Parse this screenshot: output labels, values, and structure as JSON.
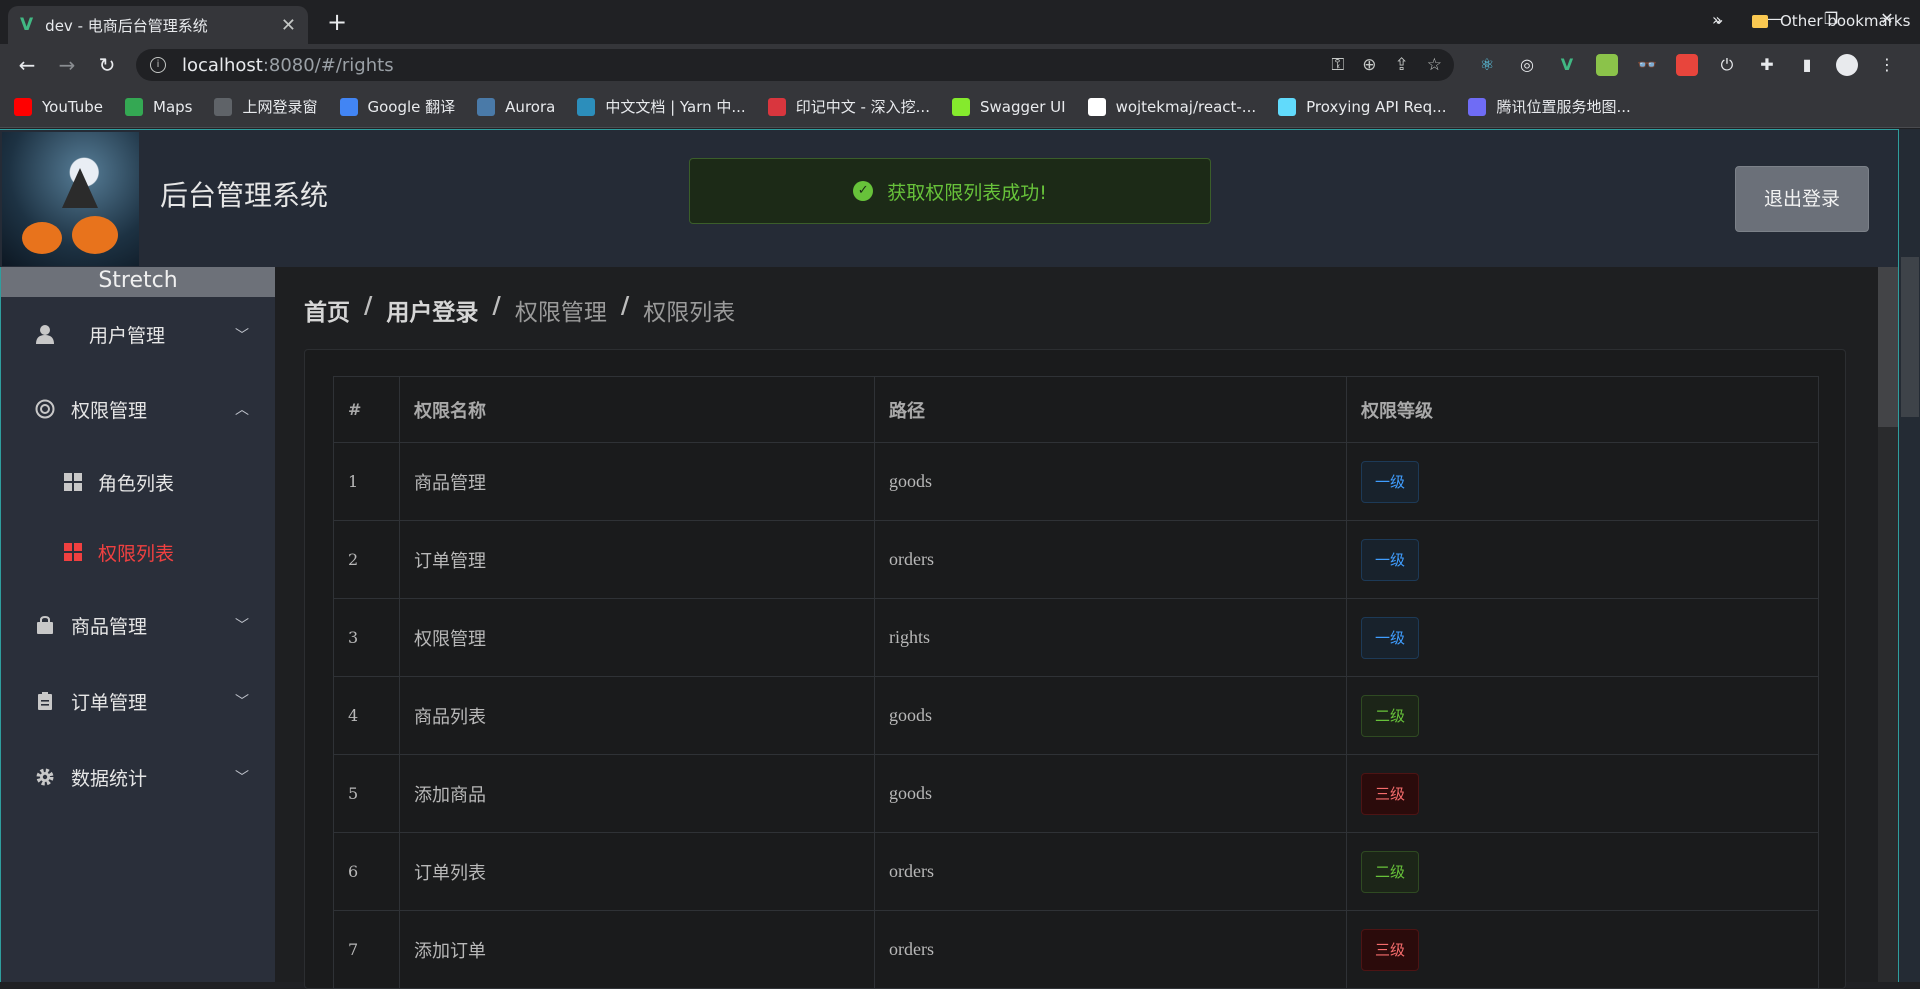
{
  "browser": {
    "tab_title": "dev - 电商后台管理系统",
    "tab_favicon": "V",
    "url_host": "localhost",
    "url_path": ":8080/#/rights",
    "bookmarks": [
      {
        "label": "YouTube",
        "icon": "youtube-icon",
        "color": "#ff0000"
      },
      {
        "label": "Maps",
        "icon": "maps-icon",
        "color": "#34a853"
      },
      {
        "label": "上网登录窗",
        "icon": "globe-icon",
        "color": "#5f6368"
      },
      {
        "label": "Google 翻译",
        "icon": "translate-icon",
        "color": "#4285f4"
      },
      {
        "label": "Aurora",
        "icon": "aurora-icon",
        "color": "#4a7aa8"
      },
      {
        "label": "中文文档 | Yarn 中...",
        "icon": "yarn-icon",
        "color": "#2c8ebb"
      },
      {
        "label": "印记中文 - 深入挖...",
        "icon": "docschina-icon",
        "color": "#d9363e"
      },
      {
        "label": "Swagger UI",
        "icon": "swagger-icon",
        "color": "#85ea2d"
      },
      {
        "label": "wojtekmaj/react-...",
        "icon": "github-icon",
        "color": "#ffffff"
      },
      {
        "label": "Proxying API Req...",
        "icon": "react-icon",
        "color": "#61dafb"
      },
      {
        "label": "腾讯位置服务地图...",
        "icon": "tencent-map-icon",
        "color": "#6f6cf5"
      }
    ],
    "bookmarks_more": "»",
    "other_bookmarks": "Other bookmarks"
  },
  "header": {
    "title": "后台管理系统",
    "toast": "获取权限列表成功!",
    "logout": "退出登录"
  },
  "sidebar": {
    "toggle": "Stretch",
    "menus": [
      {
        "label": "用户管理",
        "icon": "user-icon"
      },
      {
        "label": "权限管理",
        "icon": "permission-icon"
      },
      {
        "label": "商品管理",
        "icon": "shopping-bag-icon"
      },
      {
        "label": "订单管理",
        "icon": "order-icon"
      },
      {
        "label": "数据统计",
        "icon": "gear-icon"
      }
    ],
    "submenus": [
      {
        "label": "角色列表"
      },
      {
        "label": "权限列表"
      }
    ]
  },
  "breadcrumb": {
    "items": [
      "首页",
      "用户登录",
      "权限管理",
      "权限列表"
    ],
    "separator": "/"
  },
  "table": {
    "headers": [
      "#",
      "权限名称",
      "路径",
      "权限等级"
    ],
    "rows": [
      {
        "id": "1",
        "name": "商品管理",
        "path": "goods",
        "level": "一级"
      },
      {
        "id": "2",
        "name": "订单管理",
        "path": "orders",
        "level": "一级"
      },
      {
        "id": "3",
        "name": "权限管理",
        "path": "rights",
        "level": "一级"
      },
      {
        "id": "4",
        "name": "商品列表",
        "path": "goods",
        "level": "二级"
      },
      {
        "id": "5",
        "name": "添加商品",
        "path": "goods",
        "level": "三级"
      },
      {
        "id": "6",
        "name": "订单列表",
        "path": "orders",
        "level": "二级"
      },
      {
        "id": "7",
        "name": "添加订单",
        "path": "orders",
        "level": "三级"
      }
    ]
  },
  "colors": {
    "level_1": "#409eff",
    "level_2": "#67c23a",
    "level_3": "#f56c6c",
    "active_menu": "#f04040",
    "toast_success": "#67c23a"
  }
}
